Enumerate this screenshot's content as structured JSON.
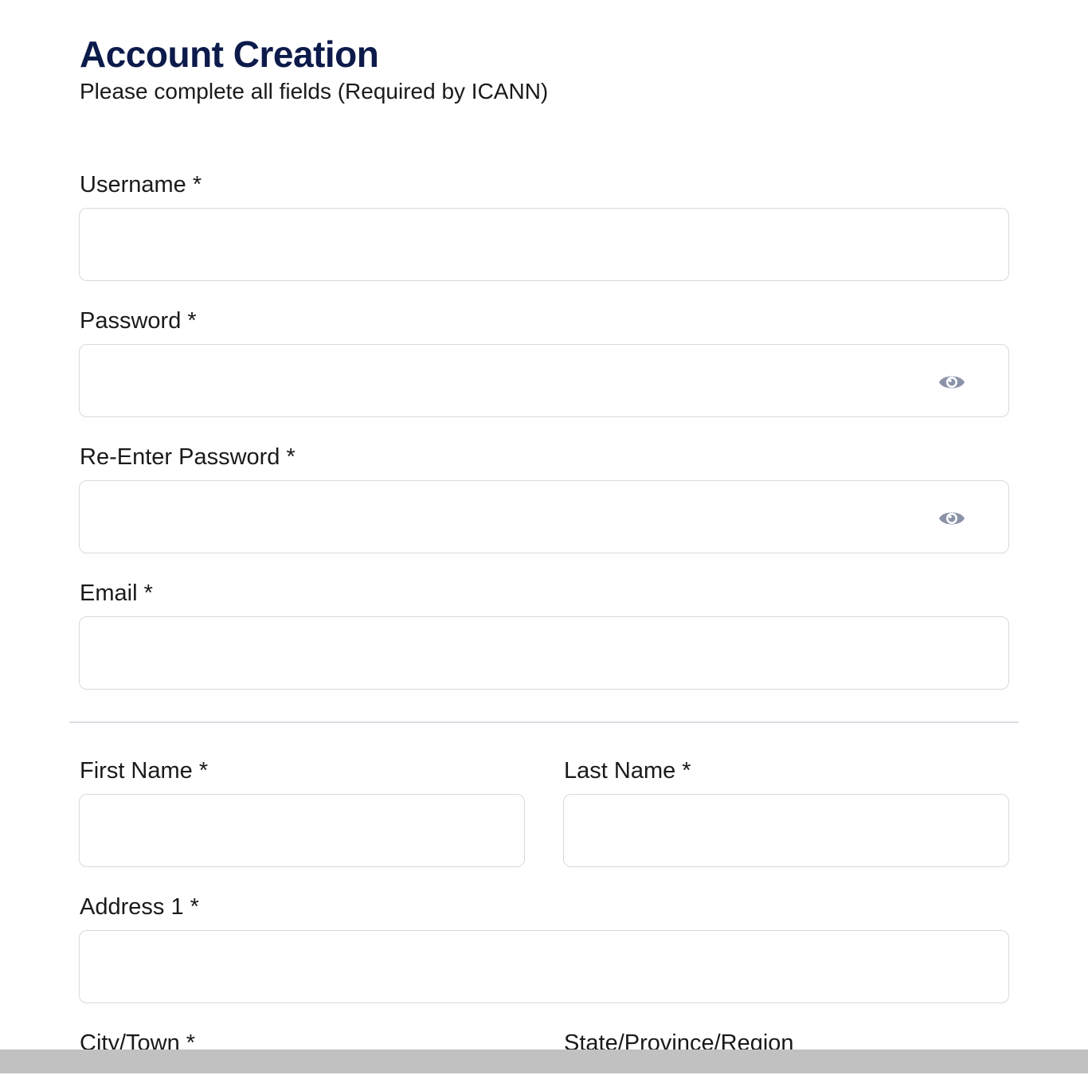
{
  "header": {
    "title": "Account Creation",
    "subtitle": "Please complete all fields (Required by ICANN)"
  },
  "fields": {
    "username": {
      "label": "Username *",
      "value": ""
    },
    "password": {
      "label": "Password *",
      "value": ""
    },
    "reenter_password": {
      "label": "Re-Enter Password *",
      "value": ""
    },
    "email": {
      "label": "Email *",
      "value": ""
    },
    "first_name": {
      "label": "First Name *",
      "value": ""
    },
    "last_name": {
      "label": "Last Name *",
      "value": ""
    },
    "address1": {
      "label": "Address 1 *",
      "value": ""
    },
    "city": {
      "label": "City/Town *"
    },
    "state": {
      "label": "State/Province/Region"
    }
  },
  "icons": {
    "password_toggle": "eye-icon",
    "reenter_password_toggle": "eye-icon"
  },
  "colors": {
    "title": "#0d1b4b",
    "input_border": "#d5d9e0",
    "eye_icon": "#8a93a8",
    "scrollbar": "#c1c1c1"
  }
}
